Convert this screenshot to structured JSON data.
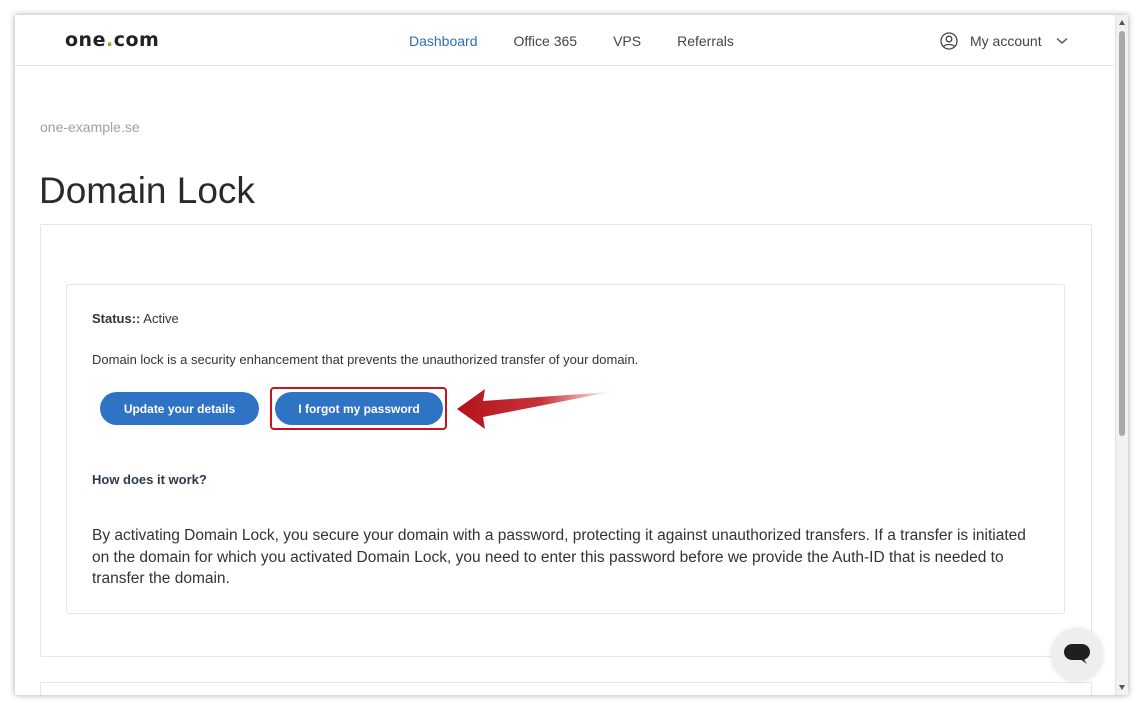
{
  "header": {
    "logo_main": "one",
    "logo_dot": ".",
    "logo_tld": "com",
    "nav": [
      {
        "label": "Dashboard",
        "active": true
      },
      {
        "label": "Office 365",
        "active": false
      },
      {
        "label": "VPS",
        "active": false
      },
      {
        "label": "Referrals",
        "active": false
      }
    ],
    "account_label": "My account"
  },
  "breadcrumb": "one-example.se",
  "page_title": "Domain Lock",
  "status": {
    "label": "Status::",
    "value": "Active"
  },
  "description": "Domain lock is a security enhancement that prevents the unauthorized transfer of your domain.",
  "buttons": {
    "update": "Update your details",
    "forgot": "I forgot my password"
  },
  "how_heading": "How does it work?",
  "how_text": "By activating Domain Lock, you secure your domain with a password, protecting it against unauthorized transfers. If a transfer is initiated on the domain for which you activated Domain Lock, you need to enter this password before we provide the Auth-ID that is needed to transfer the domain.",
  "colors": {
    "accent": "#2f73c4",
    "brand_dot": "#76b82a",
    "highlight": "#c4161c"
  },
  "icons": {
    "account": "user-circle-icon",
    "dropdown": "chevron-down-icon",
    "chat": "chat-bubble-icon",
    "annotation": "red-arrow-icon"
  }
}
